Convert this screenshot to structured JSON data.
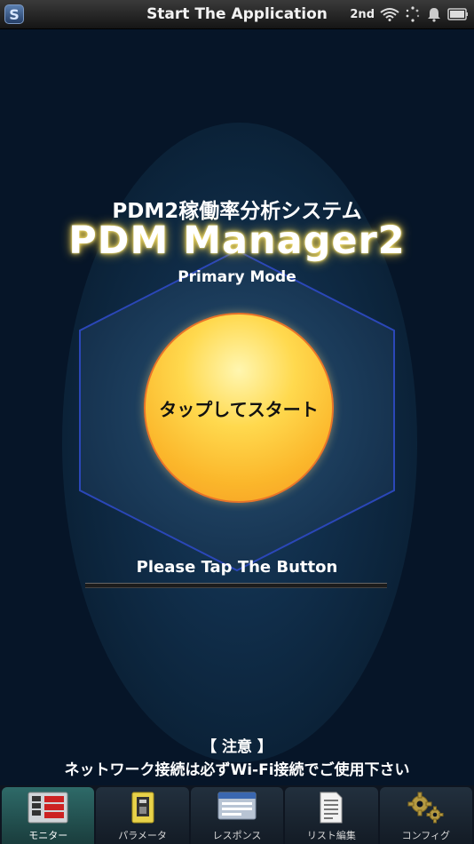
{
  "status_bar": {
    "logo_letter": "S",
    "title": "Start The Application",
    "indicator_2nd": "2nd",
    "icons": [
      "wifi-icon",
      "spinner-icon",
      "bell-icon",
      "battery-icon"
    ]
  },
  "main": {
    "subtitle": "PDM2稼働率分析システム",
    "app_name": "PDM Manager2",
    "mode": "Primary Mode",
    "start_button_label": "タップしてスタート",
    "tap_prompt": "Please Tap The Button"
  },
  "notice": {
    "heading": "【 注意 】",
    "text": "ネットワーク接続は必ずWi-Fi接続でご使用下さい"
  },
  "tabs": [
    {
      "label": "モニター",
      "icon": "monitor-icon",
      "active": true
    },
    {
      "label": "パラメータ",
      "icon": "parameter-icon",
      "active": false
    },
    {
      "label": "レスポンス",
      "icon": "response-icon",
      "active": false
    },
    {
      "label": "リスト編集",
      "icon": "list-edit-icon",
      "active": false
    },
    {
      "label": "コンフィグ",
      "icon": "gear-icon",
      "active": false
    }
  ],
  "colors": {
    "background": "#061528",
    "button_fill": "#fbb72b",
    "button_border": "#e8742a",
    "title_glow": "#f6e06a",
    "hexagon_stroke": "#2b47b8",
    "active_tab": "#2e6a68"
  }
}
